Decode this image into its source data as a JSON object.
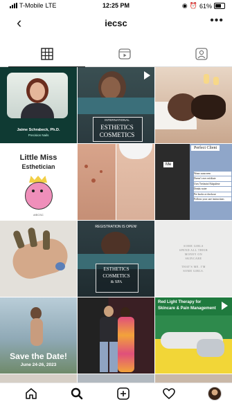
{
  "status": {
    "carrier": "T-Mobile",
    "network": "LTE",
    "time": "12:25 PM",
    "battery": "61%"
  },
  "header": {
    "title": "iecsc",
    "back_icon": "chevron-left-icon",
    "more_icon": "more-dots-icon"
  },
  "tabs": [
    {
      "name": "posts-grid-tab",
      "icon": "grid-icon",
      "active": true
    },
    {
      "name": "reels-tab",
      "icon": "reels-icon",
      "active": false
    },
    {
      "name": "tagged-tab",
      "icon": "tagged-person-icon",
      "active": false
    }
  ],
  "posts": {
    "p1": {
      "caption": "Jaime Schrabeck, Ph.D.",
      "subcaption": "Precision Nails"
    },
    "p2": {
      "line1": "INTERNATIONAL",
      "line2": "ESTHETICS",
      "line3": "COSMETICS"
    },
    "p4": {
      "line1": "Little Miss",
      "line2": "Esthetician",
      "tag": "#IECSC"
    },
    "p6": {
      "heading": "Perfect Client",
      "label": "Me",
      "list": [
        "Wears sunscreen",
        "Doesn't over exfoliate",
        "Uses Tretinoin/Adapalene",
        "Drinks water",
        "Pre books at checkout",
        "Follows your care instructions"
      ]
    },
    "p8": {
      "line1": "REGISTRATION IS OPEN!",
      "line2": "ESTHETICS",
      "line3": "COSMETICS",
      "line4": "& SPA"
    },
    "p9": {
      "line1": "SOME GIRLS",
      "line2": "SPEND ALL THEIR",
      "line3": "MONEY ON",
      "line4": "SKINCARE",
      "line5": "THAT'S ME. I'M",
      "line6": "SOME GIRLS."
    },
    "p10": {
      "headline": "Save the Date!",
      "date": "June 24-26, 2023"
    },
    "p12": {
      "line1": "Red Light Therapy for",
      "line2": "Skincare & Pain Management"
    }
  },
  "nav": [
    {
      "name": "home-icon"
    },
    {
      "name": "search-icon"
    },
    {
      "name": "new-post-icon"
    },
    {
      "name": "activity-heart-icon"
    },
    {
      "name": "profile-avatar"
    }
  ]
}
